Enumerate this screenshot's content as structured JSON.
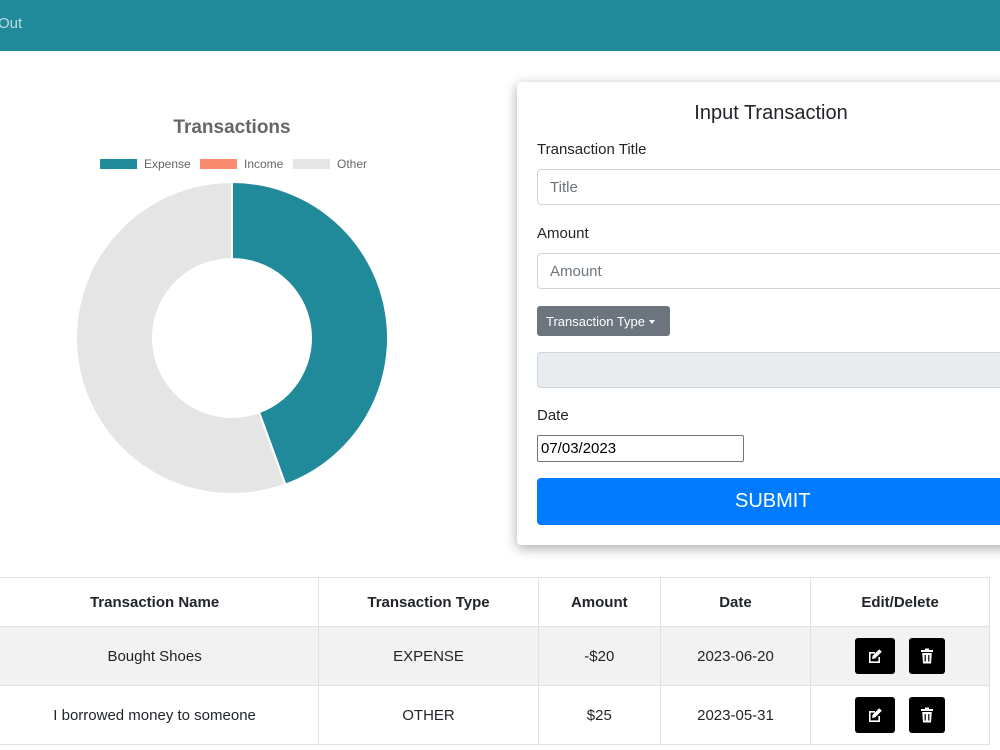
{
  "header": {
    "signout_label": "Out",
    "bg_color": "#208a9a"
  },
  "chart_data": {
    "type": "pie",
    "title": "Transactions",
    "categories": [
      "Expense",
      "Income",
      "Other"
    ],
    "values": [
      20,
      0,
      25
    ],
    "colors": [
      "#208a9a",
      "#fb8b6e",
      "#e5e5e5"
    ],
    "legend_position": "top"
  },
  "form": {
    "title": "Input Transaction",
    "title_label": "Transaction Title",
    "title_placeholder": "Title",
    "amount_label": "Amount",
    "amount_placeholder": "Amount",
    "type_button_label": "Transaction Type",
    "type_selected": "",
    "date_label": "Date",
    "date_value": "07/03/2023",
    "submit_label": "SUBMIT"
  },
  "table": {
    "headers": [
      "Transaction Name",
      "Transaction Type",
      "Amount",
      "Date",
      "Edit/Delete"
    ],
    "rows": [
      {
        "name": "Bought Shoes",
        "type": "EXPENSE",
        "amount": "-$20",
        "date": "2023-06-20"
      },
      {
        "name": "I borrowed money to someone",
        "type": "OTHER",
        "amount": "$25",
        "date": "2023-05-31"
      }
    ]
  },
  "icons": {
    "edit": "edit-icon",
    "delete": "trash-icon"
  }
}
